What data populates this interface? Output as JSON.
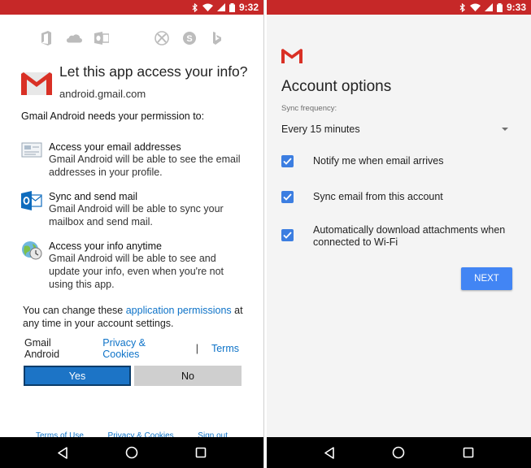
{
  "left_screen": {
    "status_bar": {
      "time": "9:32"
    },
    "consent": {
      "title": "Let this app access your info?",
      "account": "android.gmail.com",
      "intro": "Gmail Android needs your permission to:",
      "permissions": [
        {
          "title": "Access your email addresses",
          "description": "Gmail Android will be able to see the email addresses in your profile."
        },
        {
          "title": "Sync and send mail",
          "description": "Gmail Android will be able to sync your mailbox and send mail."
        },
        {
          "title": "Access your info anytime",
          "description": "Gmail Android will be able to see and update your info, even when you're not using this app."
        }
      ],
      "change_note_before": "You can change these ",
      "change_note_link": "application permissions",
      "change_note_after": " at any time in your account settings.",
      "app_name": "Gmail Android",
      "privacy_link": "Privacy & Cookies",
      "separator": "|",
      "terms_link": "Terms",
      "yes_label": "Yes",
      "no_label": "No",
      "footer": {
        "terms_of_use": "Terms of Use",
        "privacy": "Privacy & Cookies",
        "sign_out": "Sign out"
      }
    }
  },
  "right_screen": {
    "status_bar": {
      "time": "9:33"
    },
    "title": "Account options",
    "sync_label": "Sync frequency:",
    "sync_value": "Every 15 minutes",
    "options": [
      {
        "label": "Notify me when email arrives",
        "checked": true
      },
      {
        "label": "Sync email from this account",
        "checked": true
      },
      {
        "label": "Automatically download attachments when connected to Wi-Fi",
        "checked": true
      }
    ],
    "next_label": "NEXT"
  },
  "colors": {
    "status_bar": "#c62828",
    "link": "#0e73c8",
    "yes_button": "#1c74c6",
    "checkbox": "#3c7ee1",
    "next_button": "#4285f4",
    "gmail_red": "#d93025",
    "ms_red": "#f25022",
    "ms_green": "#7fba00",
    "ms_blue": "#00a4ef",
    "ms_yellow": "#ffb900"
  },
  "icons": {
    "status": [
      "bluetooth-icon",
      "wifi-icon",
      "signal-icon",
      "battery-icon"
    ],
    "ms_apps": [
      "office-icon",
      "onedrive-icon",
      "outlook-icon",
      "microsoft-logo",
      "xbox-icon",
      "skype-icon",
      "bing-icon"
    ],
    "nav": [
      "back-icon",
      "home-icon",
      "recents-icon"
    ]
  }
}
